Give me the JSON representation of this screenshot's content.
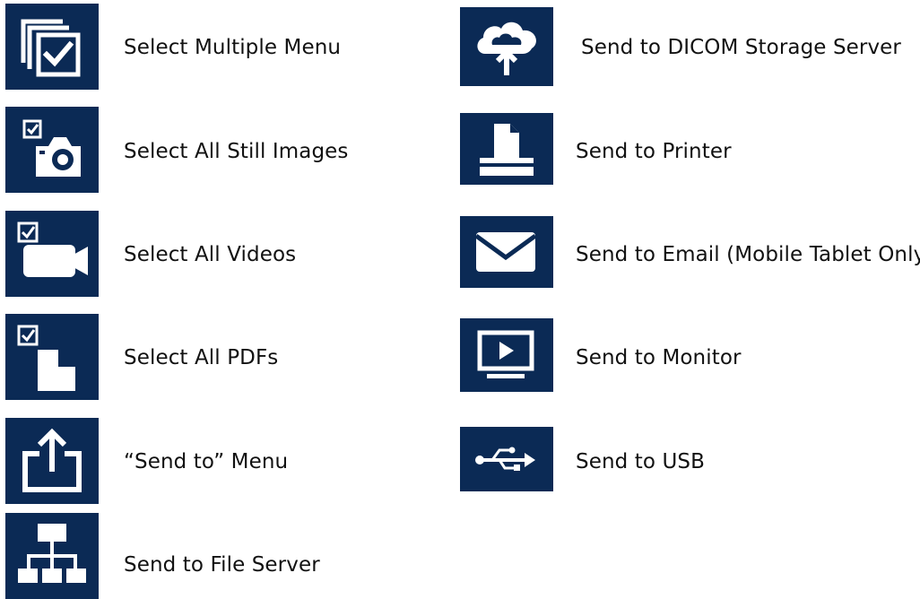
{
  "colors": {
    "tile_background": "#0b2a55",
    "icon_foreground": "#ffffff",
    "text": "#111111"
  },
  "left_column": [
    {
      "icon": "select-multiple-icon",
      "label": "Select Multiple Menu"
    },
    {
      "icon": "still-image-camera-icon",
      "label": "Select All Still Images"
    },
    {
      "icon": "video-camera-icon",
      "label": "Select All Videos"
    },
    {
      "icon": "pdf-document-icon",
      "label": "Select All PDFs"
    },
    {
      "icon": "send-to-share-icon",
      "label": "“Send to” Menu"
    },
    {
      "icon": "file-server-network-icon",
      "label": "Send to File Server"
    }
  ],
  "right_column": [
    {
      "icon": "cloud-upload-icon",
      "label": "Send to DICOM Storage Server"
    },
    {
      "icon": "printer-icon",
      "label": "Send to Printer"
    },
    {
      "icon": "email-envelope-icon",
      "label": "Send to Email (Mobile Tablet Only)"
    },
    {
      "icon": "monitor-play-icon",
      "label": "Send to Monitor"
    },
    {
      "icon": "usb-icon",
      "label": "Send to USB"
    }
  ]
}
